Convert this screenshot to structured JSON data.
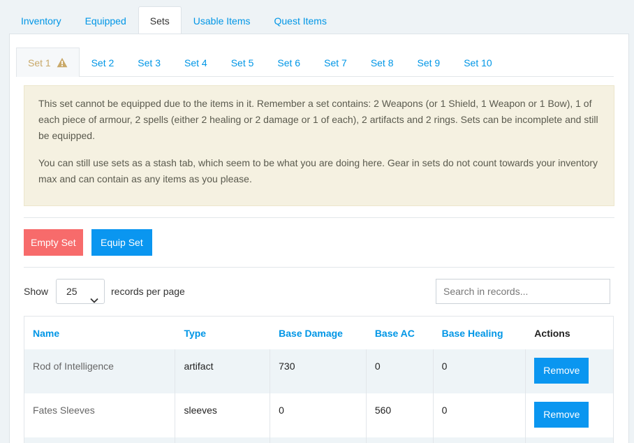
{
  "top_tabs": [
    {
      "label": "Inventory",
      "active": false
    },
    {
      "label": "Equipped",
      "active": false
    },
    {
      "label": "Sets",
      "active": true
    },
    {
      "label": "Usable Items",
      "active": false
    },
    {
      "label": "Quest Items",
      "active": false
    }
  ],
  "set_tabs": [
    "Set 1",
    "Set 2",
    "Set 3",
    "Set 4",
    "Set 5",
    "Set 6",
    "Set 7",
    "Set 8",
    "Set 9",
    "Set 10"
  ],
  "active_set_icon": "warning-icon",
  "colors": {
    "accent": "#0096e6",
    "danger": "#f76b6b",
    "alert_bg": "#f5f1e1",
    "warning": "#c9a96a"
  },
  "alert": {
    "paragraph1": "This set cannot be equipped due to the items in it. Remember a set contains: 2 Weapons (or 1 Shield, 1 Weapon or 1 Bow), 1 of each piece of armour, 2 spells (either 2 healing or 2 damage or 1 of each), 2 artifacts and 2 rings. Sets can be incomplete and still be equipped.",
    "paragraph2": "You can still use sets as a stash tab, which seem to be what you are doing here. Gear in sets do not count towards your inventory max and can contain as any items as you please."
  },
  "buttons": {
    "empty_set": "Empty Set",
    "equip_set": "Equip Set"
  },
  "records": {
    "show_label": "Show",
    "per_page_value": "25",
    "per_page_label": "records per page"
  },
  "search": {
    "placeholder": "Search in records..."
  },
  "table": {
    "headers": [
      "Name",
      "Type",
      "Base Damage",
      "Base AC",
      "Base Healing",
      "Actions"
    ],
    "rows": [
      {
        "name": "Rod of Intelligence",
        "type": "artifact",
        "base_damage": "730",
        "base_ac": "0",
        "base_healing": "0",
        "action": "Remove"
      },
      {
        "name": "Fates Sleeves",
        "type": "sleeves",
        "base_damage": "0",
        "base_ac": "560",
        "base_healing": "0",
        "action": "Remove"
      }
    ]
  }
}
